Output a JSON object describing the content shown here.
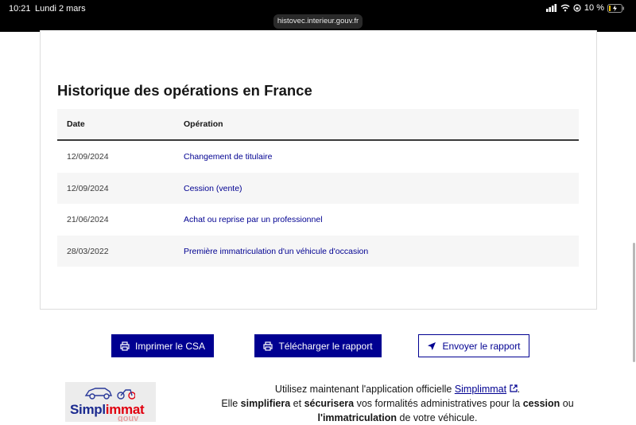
{
  "status_bar": {
    "time": "10:21",
    "date": "Lundi 2 mars",
    "battery": "10 %"
  },
  "browser": {
    "url": "histovec.interieur.gouv.fr"
  },
  "history": {
    "title": "Historique des opérations en France",
    "columns": {
      "date": "Date",
      "operation": "Opération"
    },
    "rows": [
      {
        "date": "12/09/2024",
        "operation": "Changement de titulaire"
      },
      {
        "date": "12/09/2024",
        "operation": "Cession (vente)"
      },
      {
        "date": "21/06/2024",
        "operation": "Achat ou reprise par un professionnel"
      },
      {
        "date": "28/03/2022",
        "operation": "Première immatriculation d'un véhicule d'occasion"
      }
    ]
  },
  "actions": {
    "print": "Imprimer le CSA",
    "download": "Télécharger le rapport",
    "send": "Envoyer le rapport"
  },
  "promo": {
    "logo_part1": "Simpl",
    "logo_part2": "immat",
    "logo_suffix": "gouv",
    "line1_before": "Utilisez maintenant l'application officielle ",
    "link": "Simplimmat",
    "line1_after": ".",
    "line2_a": "Elle ",
    "line2_b": "simplifiera",
    "line2_c": " et ",
    "line2_d": "sécurisera",
    "line2_e": " vos formalités administratives pour la ",
    "line2_f": "cession",
    "line2_g": " ou",
    "line3_a": "l'immatriculation",
    "line3_b": " de votre véhicule."
  },
  "colors": {
    "primary": "#000091",
    "text": "#161616",
    "row_alt": "#f6f6f6"
  }
}
